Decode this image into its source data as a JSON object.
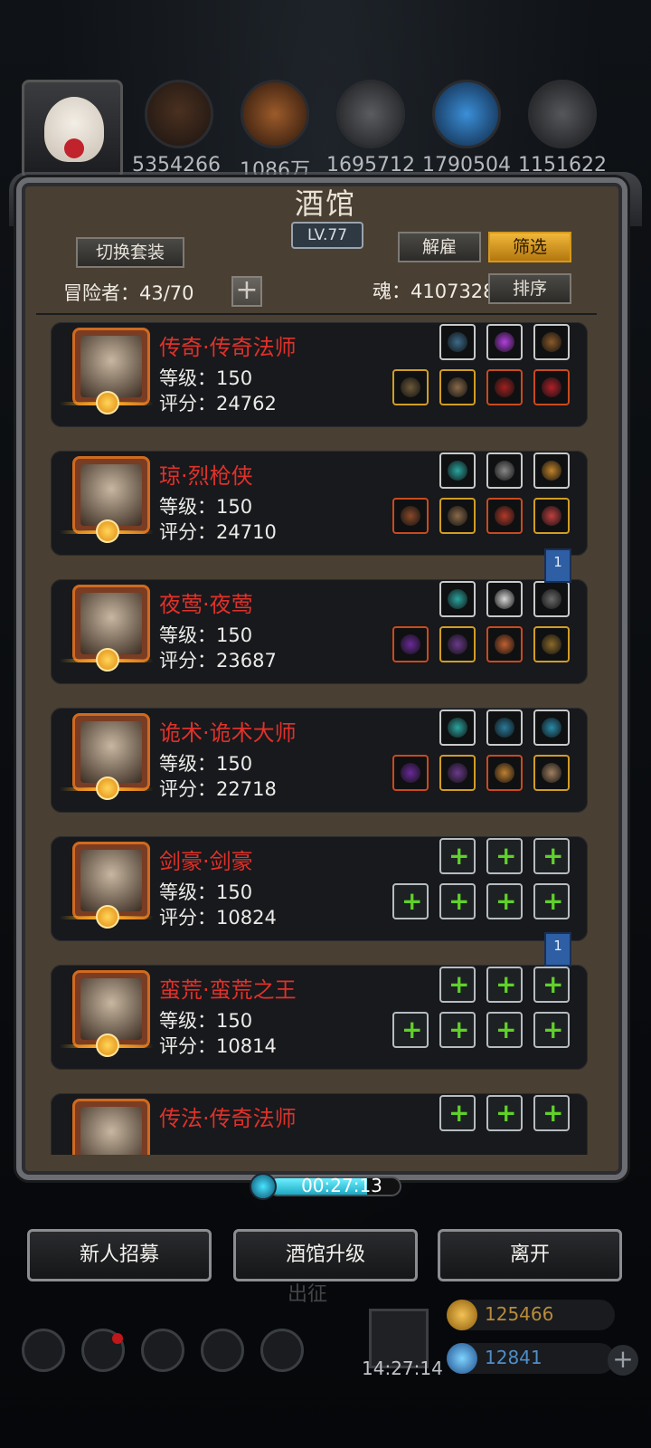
{
  "resources": {
    "numbers": [
      "5354266",
      "1086万",
      "1695712",
      "1790504",
      "1151622"
    ]
  },
  "panel": {
    "title": "酒馆",
    "level": "LV.77",
    "switch_outfit_label": "切换套装",
    "dismiss_label": "解雇",
    "filter_label": "筛选",
    "sort_label": "排序",
    "adventurers_label": "冒险者：43/70",
    "soul_label": "魂：4107328",
    "add_symbol": "+"
  },
  "heroes": [
    {
      "name": "传奇·传奇法师",
      "level": "等级：150",
      "score": "评分：24762",
      "equip_top": [
        "gear-icon",
        "gem-icon",
        "flask-icon"
      ],
      "equip_bottom": [
        "staff-icon",
        "armor-icon",
        "amulet-icon",
        "ring-icon"
      ],
      "empty": false
    },
    {
      "name": "琼·烈枪侠",
      "level": "等级：150",
      "score": "评分：24710",
      "equip_top": [
        "gem-icon",
        "mask-icon",
        "lantern-icon"
      ],
      "equip_bottom": [
        "rifle-icon",
        "armor-icon",
        "helm-icon",
        "bracer-icon"
      ],
      "empty": false
    },
    {
      "name": "夜莺·夜莺",
      "level": "等级：150",
      "score": "评分：23687",
      "equip_top": [
        "gem-icon",
        "stone-icon",
        "rune-icon"
      ],
      "equip_bottom": [
        "dagger-icon",
        "cloak-icon",
        "crown-icon",
        "blade-icon"
      ],
      "empty": false
    },
    {
      "name": "诡术·诡术大师",
      "level": "等级：150",
      "score": "评分：22718",
      "equip_top": [
        "gem-icon",
        "stone-icon",
        "stone-icon"
      ],
      "equip_bottom": [
        "wand-icon",
        "cloak-icon",
        "crown-icon",
        "gauntlet-icon"
      ],
      "empty": false
    },
    {
      "name": "剑豪·剑豪",
      "level": "等级：150",
      "score": "评分：10824",
      "empty": true
    },
    {
      "name": "蛮荒·蛮荒之王",
      "level": "等级：150",
      "score": "评分：10814",
      "empty": true
    },
    {
      "name": "传法·传奇法师",
      "level": "",
      "score": "",
      "empty": true
    }
  ],
  "bookmarks": [
    "1",
    "1"
  ],
  "timer": {
    "text": "00:27:13",
    "progress": 0.75
  },
  "buttons": {
    "recruit": "新人招募",
    "upgrade": "酒馆升级",
    "leave": "离开"
  },
  "background": {
    "deploy": "出征",
    "gift_time": "14:27:14",
    "gold": "125466",
    "gems": "12841"
  },
  "colors": {
    "hero_name": "#e0312a",
    "filter_gold": "#f0b73a",
    "equip_plus": "#5fd12a"
  }
}
